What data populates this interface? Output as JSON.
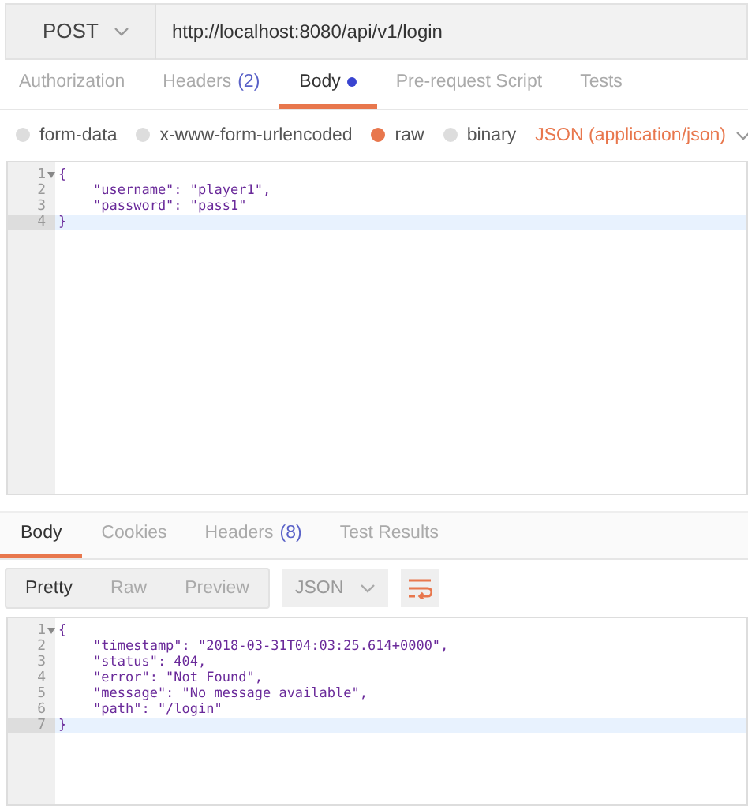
{
  "request": {
    "method": "POST",
    "url": "http://localhost:8080/api/v1/login"
  },
  "request_tabs": [
    {
      "label": "Authorization",
      "selected": false,
      "dot": false
    },
    {
      "label": "Headers",
      "count": "(2)",
      "selected": false,
      "dot": false
    },
    {
      "label": "Body",
      "selected": true,
      "dot": true
    },
    {
      "label": "Pre-request Script",
      "selected": false,
      "dot": false
    },
    {
      "label": "Tests",
      "selected": false,
      "dot": false
    }
  ],
  "body_types": [
    {
      "label": "form-data",
      "selected": false
    },
    {
      "label": "x-www-form-urlencoded",
      "selected": false
    },
    {
      "label": "raw",
      "selected": true
    },
    {
      "label": "binary",
      "selected": false
    }
  ],
  "content_type": "JSON (application/json)",
  "request_body": [
    {
      "number": "1",
      "kind": "brace",
      "text": "{",
      "foldable": true,
      "highlighted": false
    },
    {
      "number": "2",
      "kind": "member",
      "text": "\"username\": \"player1\",",
      "foldable": false,
      "highlighted": false
    },
    {
      "number": "3",
      "kind": "member",
      "text": "\"password\": \"pass1\"",
      "foldable": false,
      "highlighted": false
    },
    {
      "number": "4",
      "kind": "brace",
      "text": "}",
      "foldable": false,
      "highlighted": true
    }
  ],
  "response_tabs": [
    {
      "label": "Body",
      "selected": true
    },
    {
      "label": "Cookies",
      "selected": false
    },
    {
      "label": "Headers",
      "count": "(8)",
      "selected": false
    },
    {
      "label": "Test Results",
      "selected": false
    }
  ],
  "view_modes": [
    {
      "label": "Pretty",
      "selected": true
    },
    {
      "label": "Raw",
      "selected": false
    },
    {
      "label": "Preview",
      "selected": false
    }
  ],
  "format": "JSON",
  "response_body": [
    {
      "number": "1",
      "kind": "brace",
      "text": "{",
      "foldable": true,
      "highlighted": false
    },
    {
      "number": "2",
      "kind": "member",
      "text": "\"timestamp\": \"2018-03-31T04:03:25.614+0000\",",
      "foldable": false,
      "highlighted": false
    },
    {
      "number": "3",
      "kind": "member",
      "text": "\"status\": 404,",
      "foldable": false,
      "highlighted": false
    },
    {
      "number": "4",
      "kind": "member",
      "text": "\"error\": \"Not Found\",",
      "foldable": false,
      "highlighted": false
    },
    {
      "number": "5",
      "kind": "member",
      "text": "\"message\": \"No message available\",",
      "foldable": false,
      "highlighted": false
    },
    {
      "number": "6",
      "kind": "member",
      "text": "\"path\": \"/login\"",
      "foldable": false,
      "highlighted": false
    },
    {
      "number": "7",
      "kind": "brace",
      "text": "}",
      "foldable": false,
      "highlighted": true
    }
  ]
}
